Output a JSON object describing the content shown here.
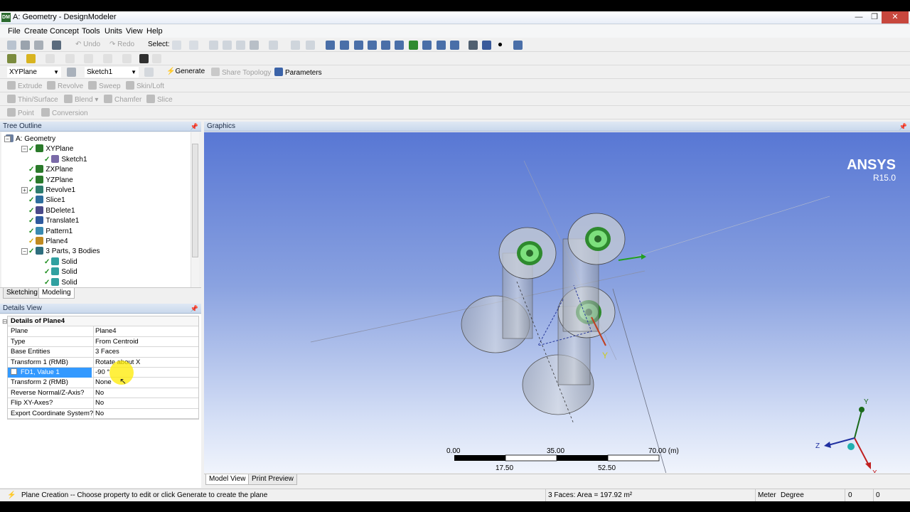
{
  "window": {
    "title": "A: Geometry - DesignModeler",
    "app_icon": "DM",
    "minimize": "—",
    "maximize": "❐",
    "close": "✕"
  },
  "menu": [
    "File",
    "Create",
    "Concept",
    "Tools",
    "Units",
    "View",
    "Help"
  ],
  "toolbar1": {
    "undo": "Undo",
    "redo": "Redo",
    "select_label": "Select:"
  },
  "toolbar3": {
    "plane_combo": "XYPlane",
    "sketch_combo": "Sketch1",
    "generate": "Generate",
    "share_topology": "Share Topology",
    "parameters": "Parameters"
  },
  "toolbar4": [
    "Extrude",
    "Revolve",
    "Sweep",
    "Skin/Loft"
  ],
  "toolbar5": [
    "Thin/Surface",
    "Blend",
    "Chamfer",
    "Slice"
  ],
  "toolbar6": [
    "Point",
    "Conversion"
  ],
  "tree_outline": {
    "header": "Tree Outline",
    "items": [
      {
        "label": "A: Geometry",
        "indent": 0
      },
      {
        "label": "XYPlane",
        "indent": 1
      },
      {
        "label": "Sketch1",
        "indent": 2
      },
      {
        "label": "ZXPlane",
        "indent": 1
      },
      {
        "label": "YZPlane",
        "indent": 1
      },
      {
        "label": "Revolve1",
        "indent": 1
      },
      {
        "label": "Slice1",
        "indent": 1
      },
      {
        "label": "BDelete1",
        "indent": 1
      },
      {
        "label": "Translate1",
        "indent": 1
      },
      {
        "label": "Pattern1",
        "indent": 1
      },
      {
        "label": "Plane4",
        "indent": 1
      },
      {
        "label": "3 Parts, 3 Bodies",
        "indent": 1
      },
      {
        "label": "Solid",
        "indent": 2
      },
      {
        "label": "Solid",
        "indent": 2
      },
      {
        "label": "Solid",
        "indent": 2
      }
    ],
    "tabs": [
      "Sketching",
      "Modeling"
    ]
  },
  "details_view": {
    "header": "Details View",
    "title": "Details of Plane4",
    "rows": [
      {
        "key": "Plane",
        "value": "Plane4"
      },
      {
        "key": "Type",
        "value": "From Centroid"
      },
      {
        "key": "Base Entities",
        "value": "3 Faces"
      },
      {
        "key": "Transform 1 (RMB)",
        "value": "Rotate about X"
      },
      {
        "key": "FD1, Value 1",
        "value": "-90 °"
      },
      {
        "key": "Transform 2 (RMB)",
        "value": "None"
      },
      {
        "key": "Reverse Normal/Z-Axis?",
        "value": "No"
      },
      {
        "key": "Flip XY-Axes?",
        "value": "No"
      },
      {
        "key": "Export Coordinate System?",
        "value": "No"
      }
    ]
  },
  "graphics": {
    "header": "Graphics",
    "brand": "ANSYS",
    "version": "R15.0",
    "scale_top": [
      "0.00",
      "35.00",
      "70.00 (m)"
    ],
    "scale_bottom": [
      "17.50",
      "52.50"
    ],
    "axes": {
      "x": "X",
      "y": "Y",
      "z": "Z"
    },
    "tabs": [
      "Model View",
      "Print Preview"
    ]
  },
  "status": {
    "message": "Plane Creation -- Choose property to edit or click Generate to create the plane",
    "selection": "3 Faces: Area = 197.92 m²",
    "units_length": "Meter",
    "units_angle": "Degree",
    "coord1": "0",
    "coord2": "0"
  },
  "colors": {
    "accent": "#3399ff",
    "check": "#1a8c1a",
    "face_green": "#7de07d"
  }
}
